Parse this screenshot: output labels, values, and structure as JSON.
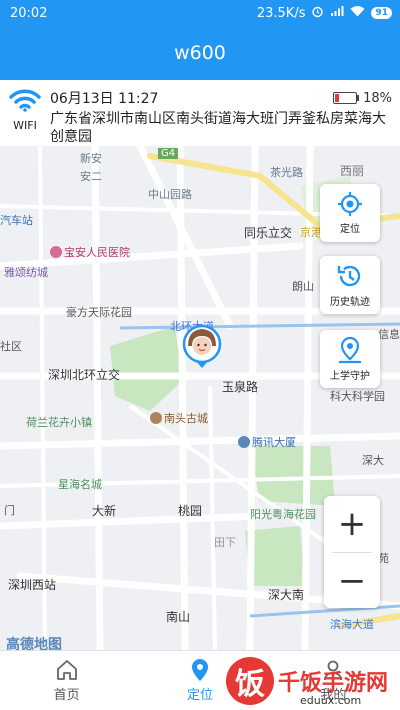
{
  "status_bar": {
    "time": "20:02",
    "net_speed": "23.5K/s",
    "battery": "91"
  },
  "app": {
    "title": "w600"
  },
  "device": {
    "wifi_label": "WIFI",
    "datetime": "06月13日 11:27",
    "battery_percent": "18%",
    "battery_level": 0.18,
    "address": "广东省深圳市南山区南头街道海大班门弄釜私房菜海大创意园"
  },
  "map": {
    "labels": {
      "xinan": "新安",
      "xinan2": "安二",
      "g4": "G4",
      "zhongshanyuan": "中山园路",
      "chaguang": "茶光路",
      "xili": "西丽",
      "qichezhan": "汽车站",
      "baoan_hospital": "宝安人民医院",
      "tongle": "同乐立交",
      "jingsheng": "京港",
      "yaji": "雅颂纺城",
      "haoji": "豪方天际花园",
      "langshan": "朗山",
      "beihuan": "北环大道",
      "shequ": "社区",
      "shenzhen_beihuan": "深圳北环立交",
      "yuquan": "玉泉路",
      "xinxi": "信息",
      "helan": "荷兰花卉小镇",
      "nantou": "南头古城",
      "kexue": "科大科学园",
      "tengxun": "腾讯大厦",
      "shenda": "深大",
      "xingming": "星海名城",
      "daxin": "大新",
      "taoyuan": "桃园",
      "yangguang": "阳光粤海花园",
      "tianxia": "田下",
      "shenzhenxizhan": "深圳西站",
      "shendanan": "深大南",
      "nanshan": "南山",
      "binhai": "滨海大道",
      "men": "门",
      "yuan": "苑",
      "amap": "高德地图"
    },
    "controls": {
      "locate": "定位",
      "history": "历史轨迹",
      "school": "上学守护",
      "zoom_in": "+",
      "zoom_out": "−"
    }
  },
  "nav": {
    "home": "首页",
    "locate": "定位",
    "mine": "我的"
  },
  "watermark": {
    "logo": "饭",
    "title": "千饭手游网",
    "url": "eduux.com"
  },
  "colors": {
    "accent": "#2196f3",
    "battery_low": "#e53935",
    "park": "#c8e6c0",
    "highway": "#fff2b3"
  }
}
